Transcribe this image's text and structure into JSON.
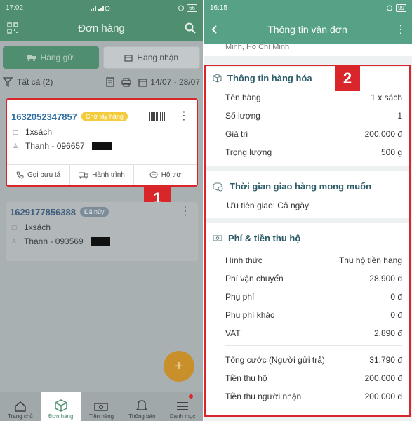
{
  "left": {
    "status_time": "17:02",
    "status_battery": "66",
    "title": "Đơn hàng",
    "tabs": [
      {
        "label": "Hàng gửi"
      },
      {
        "label": "Hàng nhận"
      }
    ],
    "filter_label": "Tất cả (2)",
    "date_range": "14/07 - 28/07",
    "orders": [
      {
        "id": "1632052347857",
        "status": "Chờ lấy hàng",
        "item": "1xsách",
        "contact": "Thanh - 096657"
      },
      {
        "id": "1629177856388",
        "status": "Đã hủy",
        "item": "1xsách",
        "contact": "Thanh - 093569"
      }
    ],
    "actions": [
      {
        "label": "Gọi bưu tá"
      },
      {
        "label": "Hành trình"
      },
      {
        "label": "Hỗ trợ"
      }
    ],
    "callout": "1",
    "fab": "+",
    "nav": [
      {
        "label": "Trang chủ"
      },
      {
        "label": "Đơn hàng"
      },
      {
        "label": "Tiền hàng"
      },
      {
        "label": "Thông báo"
      },
      {
        "label": "Danh mục"
      }
    ]
  },
  "right": {
    "status_time": "16:15",
    "status_battery": "99",
    "title": "Thông tin vận đơn",
    "address_strip": "Minh, Hồ Chí Minh",
    "callout": "2",
    "goods": {
      "title": "Thông tin hàng hóa",
      "rows": [
        {
          "label": "Tên hàng",
          "value": "1 x sách"
        },
        {
          "label": "Số lượng",
          "value": "1"
        },
        {
          "label": "Giá trị",
          "value": "200.000 đ"
        },
        {
          "label": "Trọng lượng",
          "value": "500 g"
        }
      ]
    },
    "delivery": {
      "title": "Thời gian giao hàng mong muốn",
      "text": "Ưu tiên giao: Cả ngày"
    },
    "fees": {
      "title": "Phí & tiền thu hộ",
      "rows": [
        {
          "label": "Hình thức",
          "value": "Thu hộ tiền hàng"
        },
        {
          "label": "Phí vận chuyển",
          "value": "28.900 đ"
        },
        {
          "label": "Phụ phí",
          "value": "0 đ"
        },
        {
          "label": "Phụ phí khác",
          "value": "0 đ"
        },
        {
          "label": "VAT",
          "value": "2.890 đ"
        }
      ],
      "totals": [
        {
          "label": "Tổng cước (Người gửi trả)",
          "value": "31.790 đ"
        },
        {
          "label": "Tiền thu hộ",
          "value": "200.000 đ"
        },
        {
          "label": "Tiền thu người nhận",
          "value": "200.000 đ"
        }
      ]
    }
  }
}
